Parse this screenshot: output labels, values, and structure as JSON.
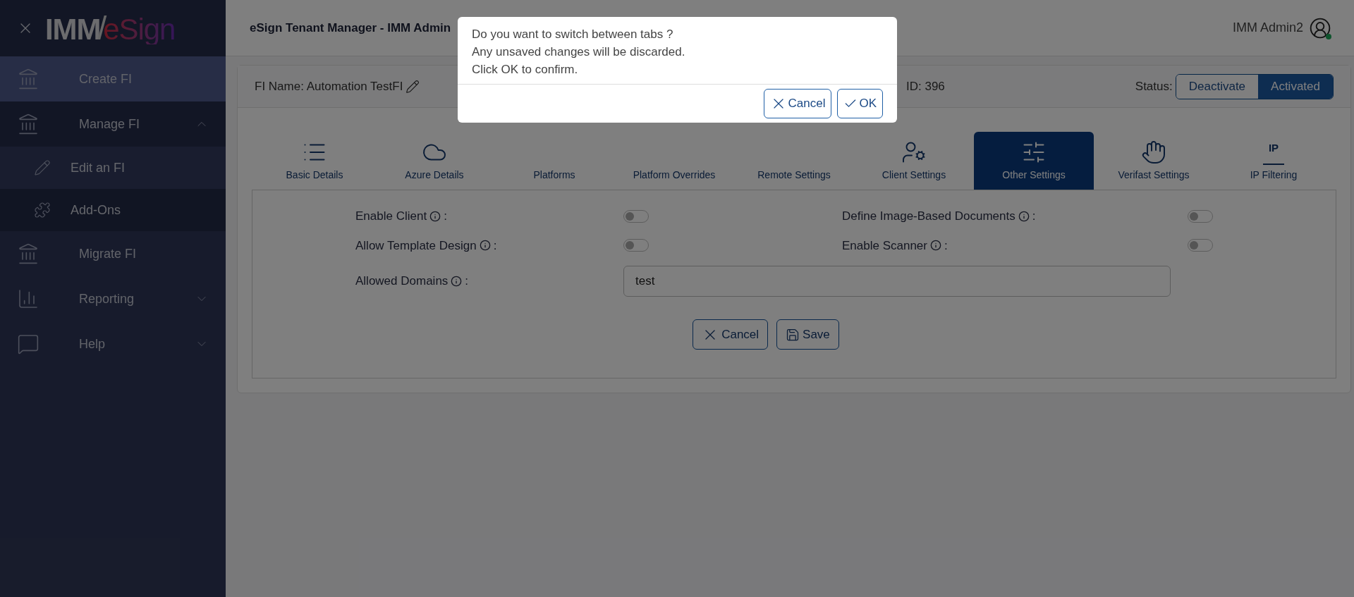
{
  "sidebar": {
    "logo": {
      "part_1": "IMM",
      "separator": "/",
      "part_2": "eSign"
    },
    "items": [
      {
        "label": "Create FI",
        "kind": "create",
        "highlighted": true
      },
      {
        "label": "Manage FI",
        "kind": "manage",
        "highlighted": false,
        "expanded": true,
        "children": [
          {
            "label": "Edit an FI",
            "kind": "edit",
            "selected": true
          },
          {
            "label": "Add-Ons",
            "kind": "addons",
            "selected": false
          }
        ]
      },
      {
        "label": "Migrate FI",
        "kind": "migrate",
        "highlighted": false
      },
      {
        "label": "Reporting",
        "kind": "reporting",
        "highlighted": false,
        "expanded": false
      },
      {
        "label": "Help",
        "kind": "help",
        "highlighted": false,
        "expanded": false
      }
    ]
  },
  "header": {
    "title": "eSign Tenant Manager - IMM Admin",
    "user": "IMM Admin2",
    "online": true
  },
  "fi_bar": {
    "name": "FI Name: Automation TestFI",
    "id": "ID: 396",
    "status_label": "Status:",
    "status_options": [
      {
        "label": "Deactivate",
        "selected": false
      },
      {
        "label": "Activated",
        "selected": true
      }
    ]
  },
  "tabs": [
    {
      "label": "Basic Details",
      "kind": "list",
      "selected": false
    },
    {
      "label": "Azure Details",
      "kind": "cloud",
      "selected": false
    },
    {
      "label": "Platforms",
      "kind": "hidden",
      "selected": false
    },
    {
      "label": "Platform Overrides",
      "kind": "hidden",
      "selected": false
    },
    {
      "label": "Remote Settings",
      "kind": "hidden",
      "selected": false
    },
    {
      "label": "Client Settings",
      "kind": "usercog",
      "selected": false
    },
    {
      "label": "Other Settings",
      "kind": "sliders",
      "selected": true
    },
    {
      "label": "Verifast Settings",
      "kind": "hand",
      "selected": false
    },
    {
      "label": "IP Filtering",
      "kind": "ip",
      "icon_text": "IP",
      "selected": false
    }
  ],
  "settings": {
    "toggles": [
      {
        "label": "Enable Client",
        "on": false
      },
      {
        "label": "Define Image-Based Documents",
        "on": false
      },
      {
        "label": "Allow Template Design",
        "on": false
      },
      {
        "label": "Enable Scanner",
        "on": false
      }
    ],
    "allowed_domains": {
      "label": "Allowed Domains",
      "value": "test"
    },
    "colon": ":",
    "buttons": [
      {
        "label": "Cancel",
        "kind": "cancel"
      },
      {
        "label": "Save",
        "kind": "save"
      }
    ]
  },
  "dialog": {
    "lines": [
      "Do you want to switch between tabs ?",
      "Any unsaved changes will be discarded.",
      "Click OK to confirm."
    ],
    "buttons": [
      {
        "label": "Cancel",
        "kind": "cancel"
      },
      {
        "label": "OK",
        "kind": "ok"
      }
    ]
  }
}
